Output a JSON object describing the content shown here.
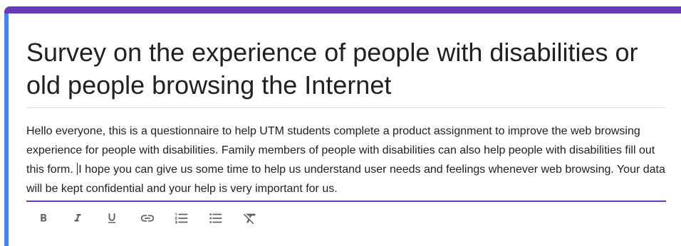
{
  "form": {
    "title": "Survey on the experience of people with disabilities or old people browsing the Internet",
    "description_part1": "Hello everyone, this is a questionnaire to help UTM students complete a product assignment to improve the web browsing experience for people with disabilities. Family members of people with disabilities can also help people with disabilities fill out this form. ",
    "description_part2": "I hope you can give us some time to help us understand user needs and feelings whenever web browsing. Your data will be kept confidential and your help is very important for us."
  },
  "toolbar": {
    "buttons": [
      "bold-icon",
      "italic-icon",
      "underline-icon",
      "link-icon",
      "numbered-list-icon",
      "bulleted-list-icon",
      "clear-formatting-icon"
    ]
  },
  "colors": {
    "theme": "#673ab7",
    "focus_bar": "#4285f4",
    "text": "#202124",
    "icon": "#5f6368"
  }
}
